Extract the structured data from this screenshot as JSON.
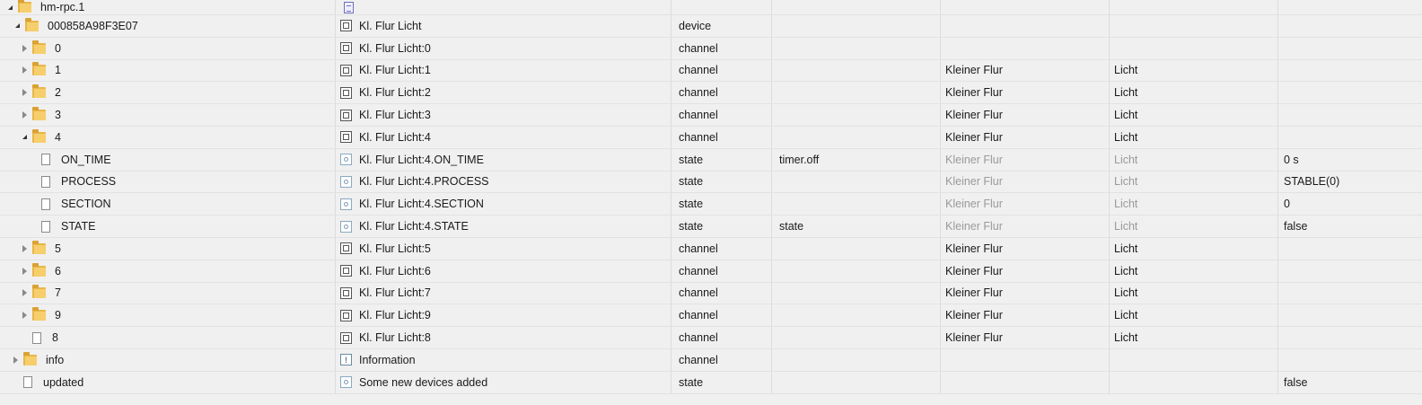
{
  "tree": {
    "root": {
      "name": "hm-rpc.1",
      "icon": "document-icon"
    },
    "device": {
      "name": "000858A98F3E07",
      "title": "Kl. Flur Licht",
      "type": "device"
    },
    "rows": [
      {
        "name": "0",
        "title": "Kl. Flur Licht:0",
        "type": "channel",
        "role": "",
        "room": "",
        "function": "",
        "value": ""
      },
      {
        "name": "1",
        "title": "Kl. Flur Licht:1",
        "type": "channel",
        "role": "",
        "room": "Kleiner Flur",
        "function": "Licht",
        "value": ""
      },
      {
        "name": "2",
        "title": "Kl. Flur Licht:2",
        "type": "channel",
        "role": "",
        "room": "Kleiner Flur",
        "function": "Licht",
        "value": ""
      },
      {
        "name": "3",
        "title": "Kl. Flur Licht:3",
        "type": "channel",
        "role": "",
        "room": "Kleiner Flur",
        "function": "Licht",
        "value": ""
      },
      {
        "name": "4",
        "title": "Kl. Flur Licht:4",
        "type": "channel",
        "role": "",
        "room": "Kleiner Flur",
        "function": "Licht",
        "value": ""
      },
      {
        "name": "ON_TIME",
        "title": "Kl. Flur Licht:4.ON_TIME",
        "type": "state",
        "role": "timer.off",
        "room": "Kleiner Flur",
        "function": "Licht",
        "value": "0 s"
      },
      {
        "name": "PROCESS",
        "title": "Kl. Flur Licht:4.PROCESS",
        "type": "state",
        "role": "",
        "room": "Kleiner Flur",
        "function": "Licht",
        "value": "STABLE(0)"
      },
      {
        "name": "SECTION",
        "title": "Kl. Flur Licht:4.SECTION",
        "type": "state",
        "role": "",
        "room": "Kleiner Flur",
        "function": "Licht",
        "value": "0"
      },
      {
        "name": "STATE",
        "title": "Kl. Flur Licht:4.STATE",
        "type": "state",
        "role": "state",
        "room": "Kleiner Flur",
        "function": "Licht",
        "value": "false"
      },
      {
        "name": "5",
        "title": "Kl. Flur Licht:5",
        "type": "channel",
        "role": "",
        "room": "Kleiner Flur",
        "function": "Licht",
        "value": ""
      },
      {
        "name": "6",
        "title": "Kl. Flur Licht:6",
        "type": "channel",
        "role": "",
        "room": "Kleiner Flur",
        "function": "Licht",
        "value": ""
      },
      {
        "name": "7",
        "title": "Kl. Flur Licht:7",
        "type": "channel",
        "role": "",
        "room": "Kleiner Flur",
        "function": "Licht",
        "value": ""
      },
      {
        "name": "9",
        "title": "Kl. Flur Licht:9",
        "type": "channel",
        "role": "",
        "room": "Kleiner Flur",
        "function": "Licht",
        "value": ""
      },
      {
        "name": "8",
        "title": "Kl. Flur Licht:8",
        "type": "channel",
        "role": "",
        "room": "Kleiner Flur",
        "function": "Licht",
        "value": ""
      },
      {
        "name": "info",
        "title": "Information",
        "type": "channel",
        "role": "",
        "room": "",
        "function": "",
        "value": ""
      },
      {
        "name": "updated",
        "title": "Some new devices added",
        "type": "state",
        "role": "",
        "room": "",
        "function": "",
        "value": "false"
      }
    ]
  },
  "colors": {
    "background": "#f0f0f0",
    "folder": "#f6cf6c",
    "muted_text": "#9a9a9a"
  }
}
